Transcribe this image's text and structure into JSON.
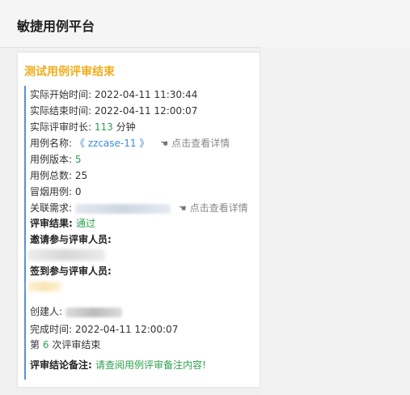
{
  "app": {
    "title": "敏捷用例平台"
  },
  "card": {
    "title": "测试用例评审结束",
    "start_time_label": "实际开始时间:",
    "start_time": "2022-04-11 11:30:44",
    "end_time_label": "实际结束时间:",
    "end_time": "2022-04-11 12:00:07",
    "duration_label": "实际评审时长:",
    "duration_value": "113",
    "duration_unit": "分钟",
    "case_name_label": "用例名称:",
    "case_name_open": "《",
    "case_name": "zzcase-11",
    "case_name_close": "》",
    "view_detail": "点击查看详情",
    "version_label": "用例版本:",
    "version": "5",
    "total_label": "用例总数:",
    "total": "25",
    "smoke_label": "冒烟用例:",
    "smoke": "0",
    "req_label": "关联需求:",
    "result_label": "评审结果:",
    "result": "通过",
    "invited_label": "邀请参与评审人员:",
    "signed_label": "签到参与评审人员:",
    "creator_label": "创建人:",
    "done_time_label": "完成时间:",
    "done_time": "2022-04-11 12:00:07",
    "round_prefix": "第",
    "round": "6",
    "round_suffix": "次评审结束",
    "remark_label": "评审结论备注:",
    "remark_link": "请查阅用例评审备注内容!"
  },
  "icons": {
    "hand": "pointing-hand-icon"
  },
  "colors": {
    "title_accent": "#f0ad1c",
    "green": "#2ea24e",
    "link_blue": "#3c8dd8",
    "bar": "#5b8fd6"
  }
}
